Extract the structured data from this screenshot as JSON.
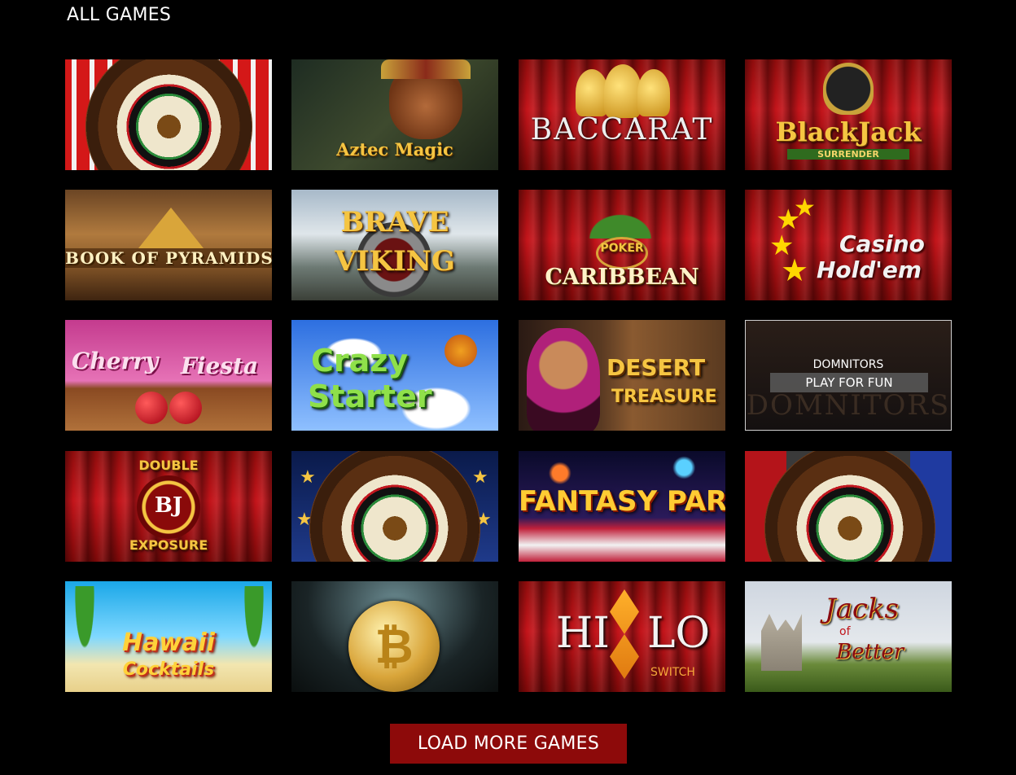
{
  "header": {
    "title": "ALL GAMES"
  },
  "games": [
    {
      "label": ""
    },
    {
      "label": "Aztec Magic"
    },
    {
      "label": "BACCARAT"
    },
    {
      "label": "BlackJack",
      "sub": "SURRENDER"
    },
    {
      "label": "BOOK OF PYRAMIDS"
    },
    {
      "label": "BRAVE",
      "sub": "VIKING"
    },
    {
      "label": "CARIBBEAN",
      "pre": "POKER"
    },
    {
      "label": "Casino",
      "sub": "Hold'em"
    },
    {
      "label": "Cherry",
      "sub": "Fiesta"
    },
    {
      "label": "Crazy",
      "sub": "Starter"
    },
    {
      "label": "DESERT",
      "sub": "TREASURE"
    },
    {
      "label": "DOMNITORS",
      "play": "PLAY FOR FUN",
      "bg_text": "DOMNITORS"
    },
    {
      "label": "BJ",
      "pre": "DOUBLE",
      "sub": "EXPOSURE"
    },
    {
      "label": ""
    },
    {
      "label": "FANTASY PARK"
    },
    {
      "label": ""
    },
    {
      "label": "Hawaii",
      "sub": "Cocktails"
    },
    {
      "label": ""
    },
    {
      "label": "HI",
      "mid": "LO",
      "sub": "SWITCH"
    },
    {
      "label": "Jacks",
      "pre": "of",
      "sub": "Better"
    }
  ],
  "footer": {
    "load_more": "LOAD MORE GAMES"
  }
}
